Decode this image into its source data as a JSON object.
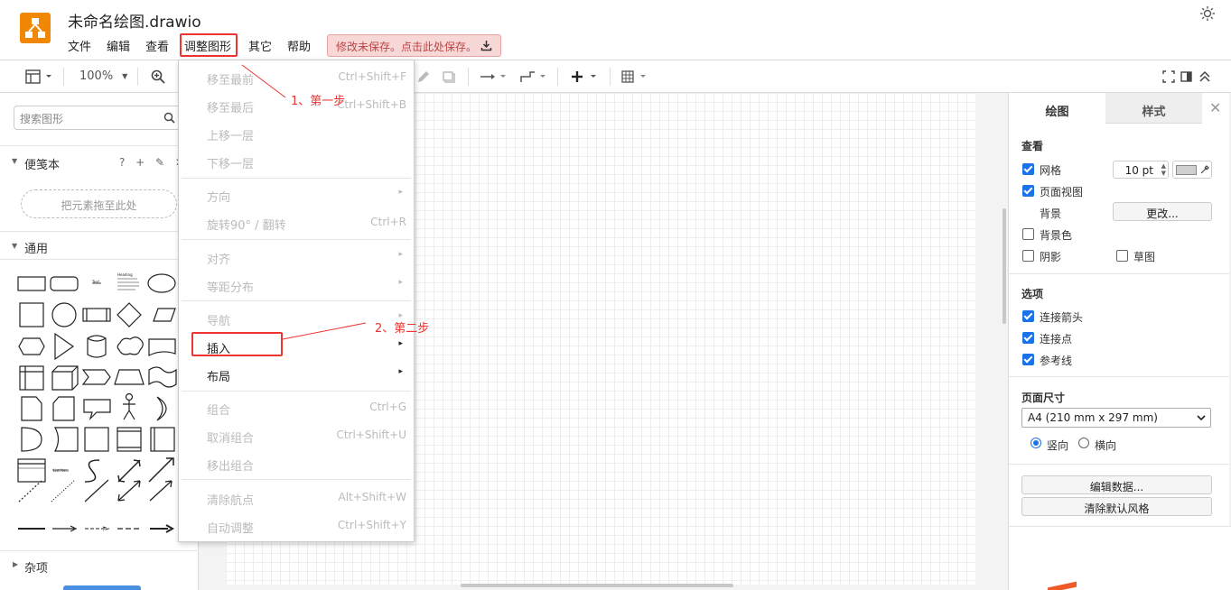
{
  "app": {
    "title": "未命名绘图.drawio"
  },
  "menu": [
    {
      "key": "file",
      "label": "文件"
    },
    {
      "key": "edit",
      "label": "编辑"
    },
    {
      "key": "view",
      "label": "查看"
    },
    {
      "key": "arrange",
      "label": "调整图形"
    },
    {
      "key": "extras",
      "label": "其它"
    },
    {
      "key": "help",
      "label": "帮助"
    }
  ],
  "save_notice": "修改未保存。点击此处保存。",
  "toolbar": {
    "zoom": "100%"
  },
  "left_panel": {
    "search_placeholder": "搜索图形",
    "scratchpad_title": "便笺本",
    "scratchpad_icons": "? + ✎ ✕",
    "drop_zone": "把元素拖至此处",
    "general_title": "通用",
    "misc_title": "杂项"
  },
  "dropdown": {
    "items": [
      {
        "label": "移至最前",
        "shortcut": "Ctrl+Shift+F",
        "enabled": false
      },
      {
        "label": "移至最后",
        "shortcut": "Ctrl+Shift+B",
        "enabled": false
      },
      {
        "label": "上移一层",
        "shortcut": "",
        "enabled": false
      },
      {
        "label": "下移一层",
        "shortcut": "",
        "enabled": false
      },
      {
        "label": "方向",
        "shortcut": "",
        "enabled": false,
        "submenu": true
      },
      {
        "label": "旋转90° / 翻转",
        "shortcut": "Ctrl+R",
        "enabled": false
      },
      {
        "label": "对齐",
        "shortcut": "",
        "enabled": false,
        "submenu": true
      },
      {
        "label": "等距分布",
        "shortcut": "",
        "enabled": false,
        "submenu": true
      },
      {
        "label": "导航",
        "shortcut": "",
        "enabled": false,
        "submenu": true
      },
      {
        "label": "插入",
        "shortcut": "",
        "enabled": true,
        "submenu": true
      },
      {
        "label": "布局",
        "shortcut": "",
        "enabled": true,
        "submenu": true
      },
      {
        "label": "组合",
        "shortcut": "Ctrl+G",
        "enabled": false
      },
      {
        "label": "取消组合",
        "shortcut": "Ctrl+Shift+U",
        "enabled": false
      },
      {
        "label": "移出组合",
        "shortcut": "",
        "enabled": false
      },
      {
        "label": "清除航点",
        "shortcut": "Alt+Shift+W",
        "enabled": false
      },
      {
        "label": "自动调整",
        "shortcut": "Ctrl+Shift+Y",
        "enabled": false
      }
    ],
    "submenu_arrow": "▸"
  },
  "annotations": {
    "step1": "1、第一步",
    "step2": "2、第二步"
  },
  "right_panel": {
    "tabs": {
      "diagram": "绘图",
      "style": "样式"
    },
    "close": "✕",
    "view_title": "查看",
    "grid_label": "网格",
    "grid_size": "10 pt",
    "page_view_label": "页面视图",
    "background_label": "背景",
    "change_button": "更改...",
    "bg_color_label": "背景色",
    "shadow_label": "阴影",
    "sketch_label": "草图",
    "options_title": "选项",
    "connection_arrows_label": "连接箭头",
    "connection_points_label": "连接点",
    "guides_label": "参考线",
    "page_size_title": "页面尺寸",
    "page_size_value": "A4 (210 mm x 297 mm)",
    "portrait_label": "竖向",
    "landscape_label": "横向",
    "edit_data_button": "编辑数据...",
    "clear_style_button": "清除默认风格",
    "checked": {
      "grid": true,
      "page_view": true,
      "bg_color": false,
      "shadow": false,
      "sketch": false,
      "connection_arrows": true,
      "connection_points": true,
      "guides": true
    },
    "orientation": "portrait"
  },
  "colors": {
    "accent": "#1a73e8",
    "logo": "#f08705",
    "annotation": "#e33333"
  }
}
